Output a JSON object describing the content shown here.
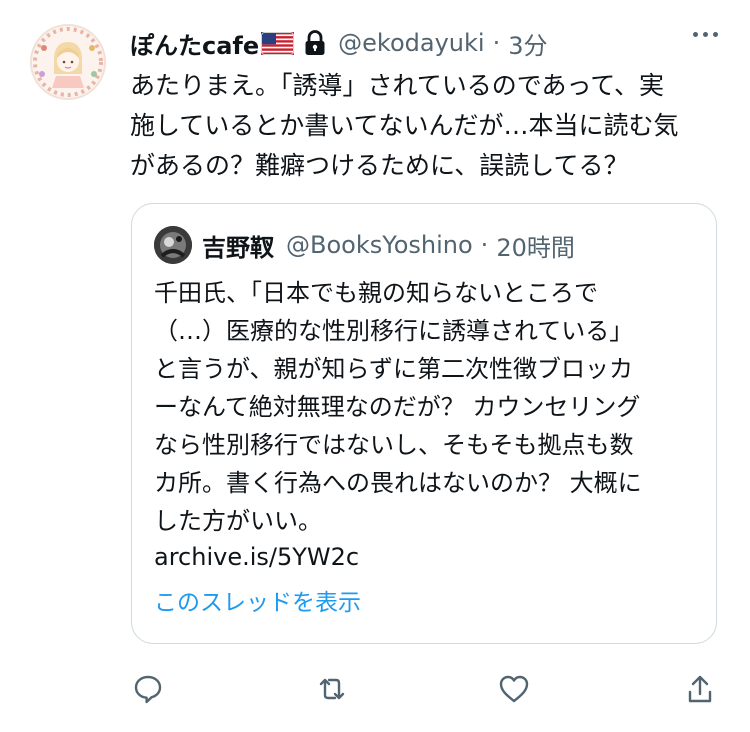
{
  "tweet": {
    "display_name": "ぽんたcafe",
    "flag_icon": "us-flag-icon",
    "lock_icon": "lock-icon",
    "handle": "@ekodayuki",
    "separator": "·",
    "time": "3分",
    "text_lines": [
      "あたりまえ。「誘導」されているのであって、実",
      "施しているとか書いてないんだが…本当に読む気",
      "があるの？難癖つけるために、誤読してる？"
    ]
  },
  "quote": {
    "display_name": "吉野靫",
    "handle": "@BooksYoshino",
    "separator": "·",
    "time": "20時間",
    "text_lines": [
      "千田氏、「日本でも親の知らないところで",
      "（…）医療的な性別移行に誘導されている」",
      "と言うが、親が知らずに第二次性徴ブロッカ",
      "ーなんて絶対無理なのだが？ カウンセリング",
      "なら性別移行ではないし、そもそも拠点も数",
      "カ所。書く行為への畏れはないのか？ 大概に",
      "した方がいい。"
    ],
    "link": "archive.is/5YW2c",
    "show_thread": "このスレッドを表示"
  },
  "actions": {
    "reply_icon": "reply-icon",
    "retweet_icon": "retweet-icon",
    "like_icon": "heart-icon",
    "share_icon": "share-icon"
  },
  "colors": {
    "text": "#0f1419",
    "secondary": "#536471",
    "accent": "#1d9bf0",
    "border": "#cfd9de"
  }
}
